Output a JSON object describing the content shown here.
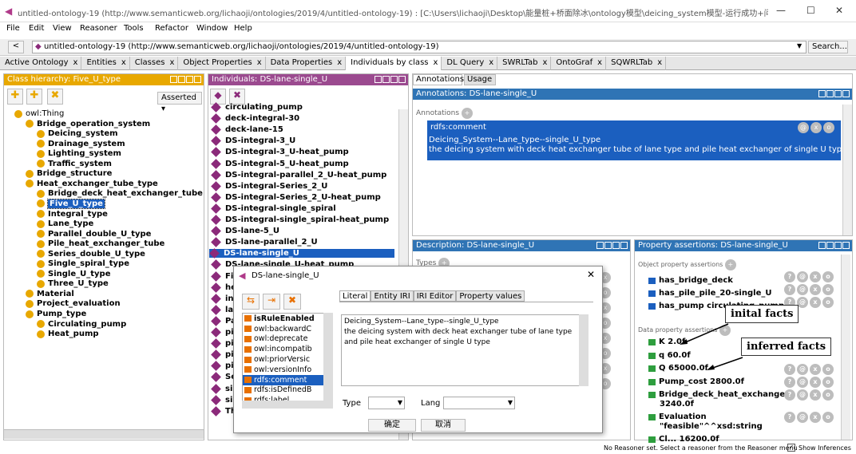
{
  "window": {
    "title": "untitled-ontology-19 (http://www.semanticweb.org/lichaoji/ontologies/2019/4/untitled-ontology-19) : [C:\\Users\\lichaoji\\Desktop\\能量桩+桥面除冰\\ontology模型\\deicing_system模型-运行成功+问题询问成功-0..."
  },
  "menu": [
    "File",
    "Edit",
    "View",
    "Reasoner",
    "Tools",
    "Refactor",
    "Window",
    "Help"
  ],
  "address": {
    "value": "untitled-ontology-19 (http://www.semanticweb.org/lichaoji/ontologies/2019/4/untitled-ontology-19)",
    "search": "Search..."
  },
  "tabs": [
    "Active Ontology",
    "Entities",
    "Classes",
    "Object Properties",
    "Data Properties",
    "Individuals by class",
    "DL Query",
    "SWRLTab",
    "OntoGraf",
    "SQWRLTab"
  ],
  "class_panel": {
    "header": "Class hierarchy: Five_U_type",
    "asserted": "Asserted",
    "tree": [
      {
        "label": "owl:Thing",
        "bold": false,
        "level": 0
      },
      {
        "label": "Bridge_operation_system",
        "bold": true,
        "level": 1
      },
      {
        "label": "Deicing_system",
        "bold": true,
        "level": 2
      },
      {
        "label": "Drainage_system",
        "bold": true,
        "level": 2
      },
      {
        "label": "Lighting_system",
        "bold": true,
        "level": 2
      },
      {
        "label": "Traffic_system",
        "bold": true,
        "level": 2
      },
      {
        "label": "Bridge_structure",
        "bold": true,
        "level": 1
      },
      {
        "label": "Heat_exchanger_tube_type",
        "bold": true,
        "level": 1
      },
      {
        "label": "Bridge_deck_heat_exchanger_tube",
        "bold": true,
        "level": 2
      },
      {
        "label": "Five_U_type",
        "bold": true,
        "level": 2,
        "selected": true
      },
      {
        "label": "Integral_type",
        "bold": true,
        "level": 2
      },
      {
        "label": "Lane_type",
        "bold": true,
        "level": 2
      },
      {
        "label": "Parallel_double_U_type",
        "bold": true,
        "level": 2
      },
      {
        "label": "Pile_heat_exchanger_tube",
        "bold": true,
        "level": 2
      },
      {
        "label": "Series_double_U_type",
        "bold": true,
        "level": 2
      },
      {
        "label": "Single_spiral_type",
        "bold": true,
        "level": 2
      },
      {
        "label": "Single_U_type",
        "bold": true,
        "level": 2
      },
      {
        "label": "Three_U_type",
        "bold": true,
        "level": 2
      },
      {
        "label": "Material",
        "bold": true,
        "level": 1
      },
      {
        "label": "Project_evaluation",
        "bold": true,
        "level": 1
      },
      {
        "label": "Pump_type",
        "bold": true,
        "level": 1
      },
      {
        "label": "Circulating_pump",
        "bold": true,
        "level": 2
      },
      {
        "label": "Heat_pump",
        "bold": true,
        "level": 2
      }
    ]
  },
  "individuals": {
    "header": "Individuals: DS-lane-single_U",
    "items": [
      "circulating_pump",
      "deck-integral-30",
      "deck-lane-15",
      "DS-integral-3_U",
      "DS-integral-3_U-heat_pump",
      "DS-integral-5_U-heat_pump",
      "DS-integral-parallel_2_U-heat_pump",
      "DS-integral-Series_2_U",
      "DS-integral-Series_2_U-heat_pump",
      "DS-integral-single_spiral",
      "DS-integral-single_spiral-heat_pump",
      "DS-lane-5_U",
      "DS-lane-parallel_2_U",
      "DS-lane-single_U",
      "DS-lane-single_U-heat_pump",
      "Five_U",
      "heat",
      "int",
      "lan",
      "Pa",
      "pil",
      "pil",
      "pil",
      "pil",
      "Se",
      "sin",
      "sin",
      "Three_U"
    ],
    "selected_index": 13
  },
  "annotations": {
    "tabs": [
      "Annotations",
      "Usage"
    ],
    "header": "Annotations: DS-lane-single_U",
    "label": "Annotations",
    "property": "rdfs:comment",
    "line1": "Deicing_System--Lane_type--single_U_type",
    "line2": "the deicing system with deck heat exchanger tube of lane type and pile heat exchanger of single U type"
  },
  "description": {
    "header": "Description: DS-lane-single_U",
    "types": "Types"
  },
  "property_assertions": {
    "header": "Property assertions: DS-lane-single_U",
    "object_label": "Object property assertions",
    "object": [
      "has_bridge_deck",
      "has_pile_pile_20-single_U",
      "has_pump circulating_pump"
    ],
    "data_label": "Data property assertions",
    "data": [
      "K  2.0f",
      "q  60.0f",
      "Q  65000.0f",
      "Pump_cost  2800.0f",
      "Bridge_deck_heat_exchanger",
      "3240.0f",
      "Evaluation",
      "\"feasible\"^^xsd:string",
      "Cl... 16200.0f"
    ]
  },
  "dialog": {
    "title": "DS-lane-single_U",
    "tabs": [
      "Literal",
      "Entity IRI",
      "IRI Editor",
      "Property values"
    ],
    "props": [
      "isRuleEnabled",
      "owl:backwardC",
      "owl:deprecate",
      "owl:incompatib",
      "owl:priorVersic",
      "owl:versionInfo",
      "rdfs:comment",
      "rdfs:isDefinedB",
      "rdfs:label"
    ],
    "selected_prop": 6,
    "text1": "Deicing_System--Lane_type--single_U_type",
    "text2": "the deicing system with deck heat exchanger tube of lane type",
    "text3": "and pile heat exchanger of single U type",
    "type_label": "Type",
    "lang_label": "Lang",
    "ok": "确定",
    "cancel": "取消"
  },
  "callouts": {
    "initial": "inital facts",
    "inferred": "inferred facts"
  },
  "status": {
    "text": "No Reasoner set. Select a reasoner from the Reasoner menu",
    "inferences": "Show Inferences"
  }
}
